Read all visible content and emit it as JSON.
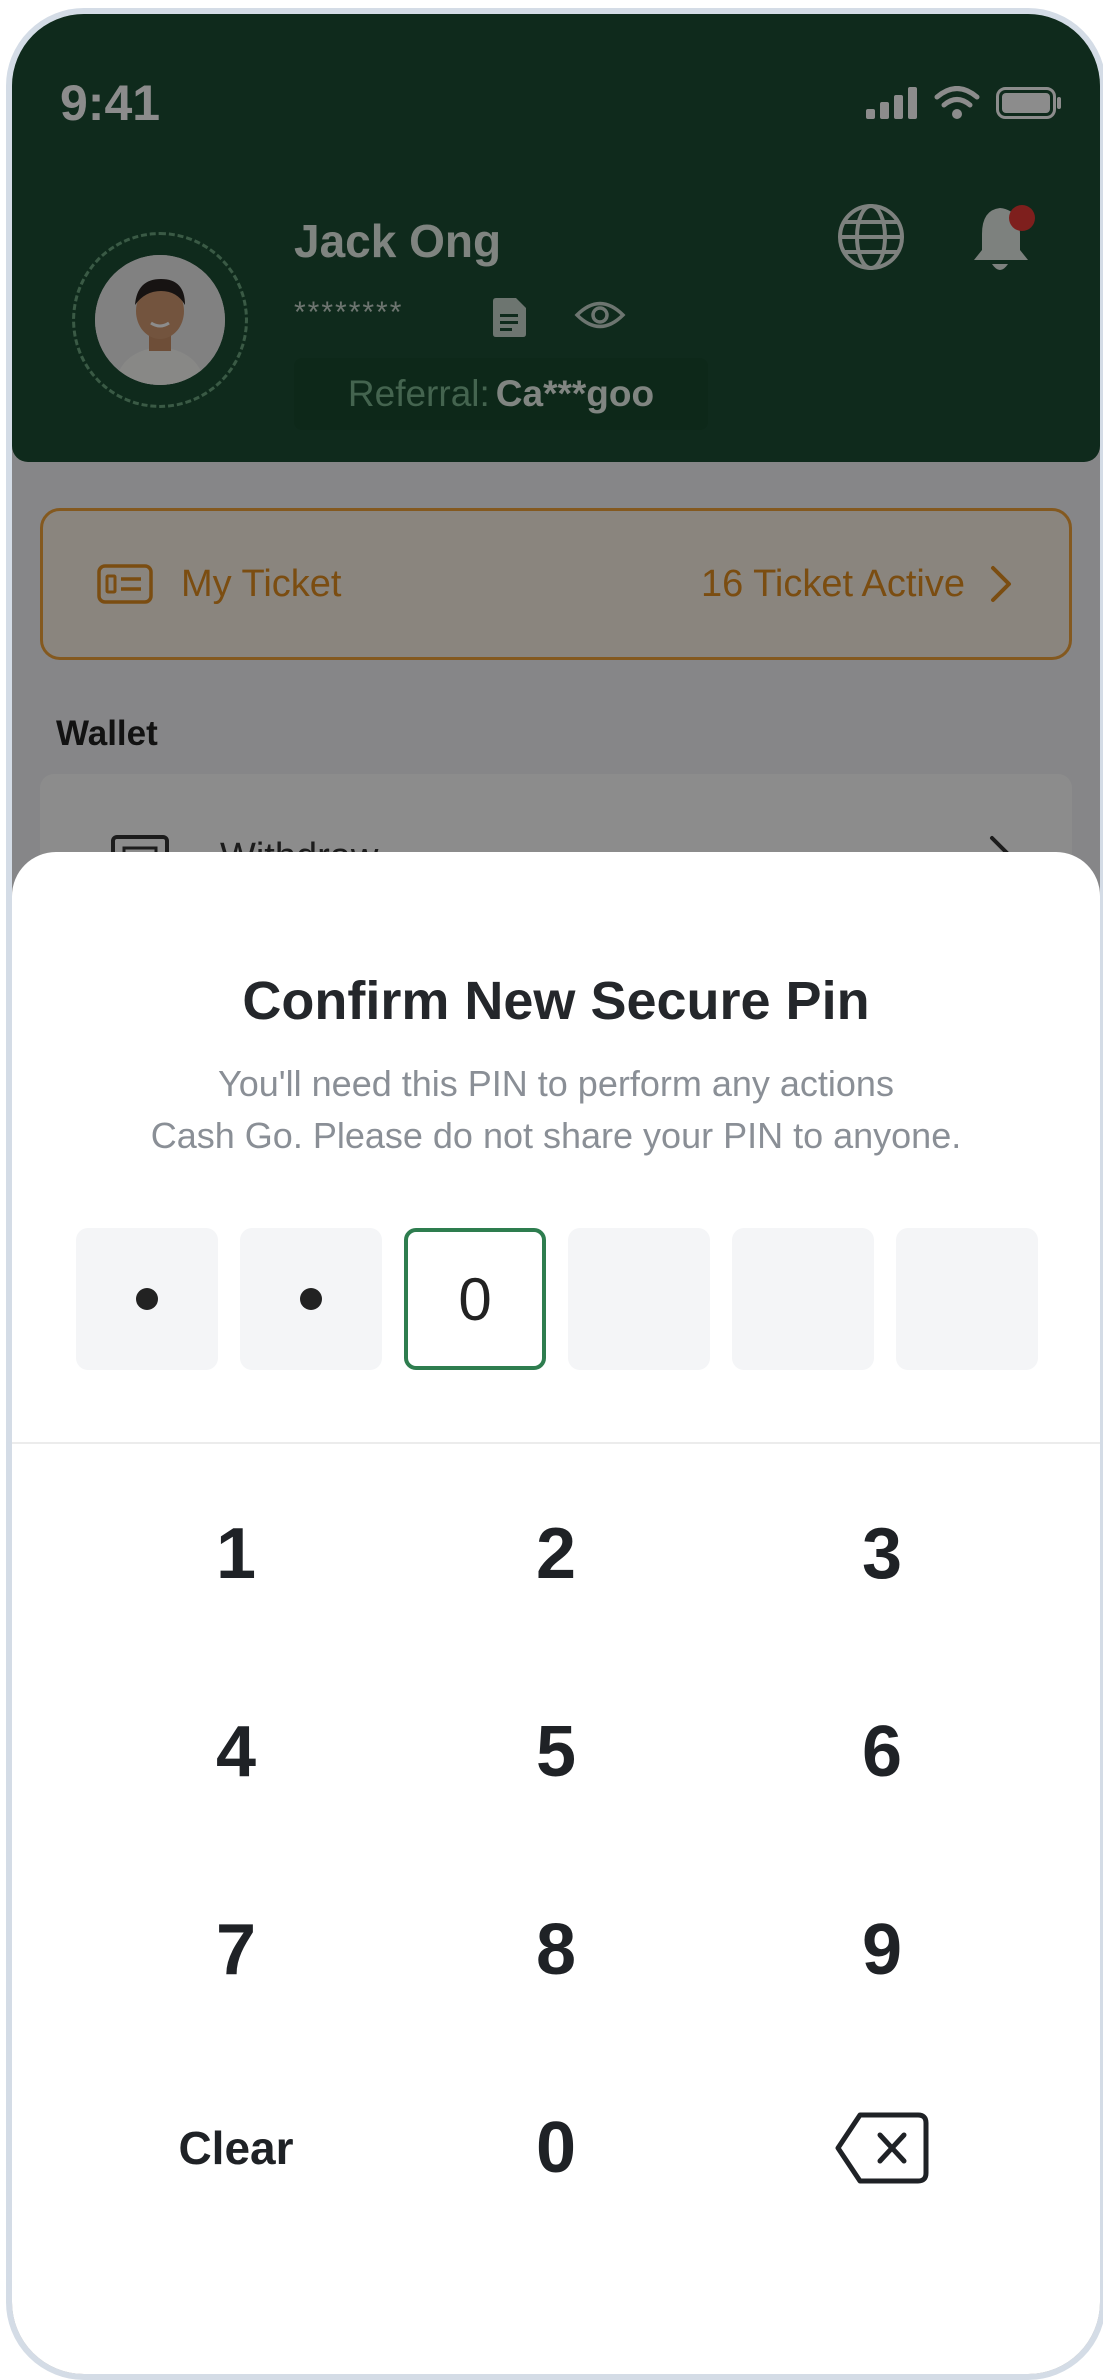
{
  "status_bar": {
    "time": "9:41",
    "icons": [
      "signal-icon",
      "wifi-icon",
      "battery-icon"
    ]
  },
  "profile": {
    "name": "Jack Ong",
    "masked_id": "********",
    "referral_label": "Referral:",
    "referral_code": "Ca***goo"
  },
  "ticket": {
    "label": "My Ticket",
    "count_text": "16 Ticket Active"
  },
  "wallet": {
    "title": "Wallet",
    "first_item": "Withdraw"
  },
  "pin_sheet": {
    "title": "Confirm New Secure Pin",
    "description_line1": "You'll need this PIN to perform any actions",
    "description_line2": "Cash Go. Please do not share your PIN to anyone.",
    "digits": [
      "•",
      "•",
      "0",
      "",
      "",
      ""
    ],
    "active_index": 2
  },
  "keypad": {
    "keys": [
      "1",
      "2",
      "3",
      "4",
      "5",
      "6",
      "7",
      "8",
      "9",
      "Clear",
      "0",
      "backspace"
    ]
  },
  "colors": {
    "brand_green": "#1d4d33",
    "accent_orange": "#f0a23a",
    "active_border": "#2e7d4f",
    "notification_dot": "#e53935"
  }
}
